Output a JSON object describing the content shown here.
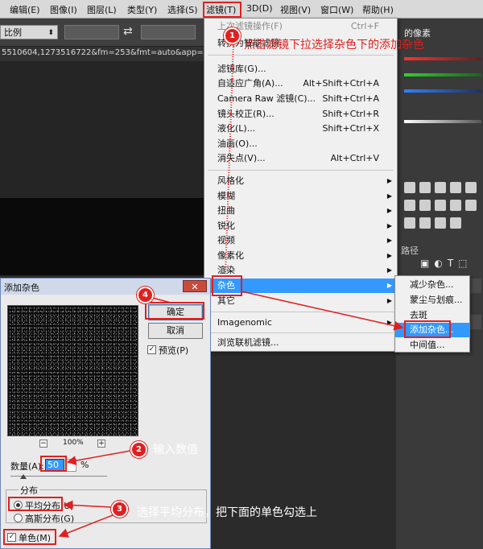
{
  "menubar": {
    "items": [
      "编辑(E)",
      "图像(I)",
      "图层(L)",
      "类型(Y)",
      "选择(S)",
      "滤镜(T)",
      "3D(D)",
      "视图(V)",
      "窗口(W)",
      "帮助(H)"
    ]
  },
  "options_bar": {
    "select_value": "比例",
    "swap_symbol": "⇄"
  },
  "tab": {
    "title": "5510604,1273516722&fm=253&fmt=auto&app=1"
  },
  "right_panel": {
    "title": "的像素",
    "layers_tab": "路径"
  },
  "filter_menu": {
    "last_filter": {
      "label": "上次滤镜操作(F)",
      "shortcut": "Ctrl+F"
    },
    "convert_smart": {
      "label": "转换为智能滤镜"
    },
    "group1": [
      {
        "label": "滤镜库(G)...",
        "shortcut": ""
      },
      {
        "label": "自适应广角(A)...",
        "shortcut": "Alt+Shift+Ctrl+A"
      },
      {
        "label": "Camera Raw 滤镜(C)...",
        "shortcut": "Shift+Ctrl+A"
      },
      {
        "label": "镜头校正(R)...",
        "shortcut": "Shift+Ctrl+R"
      },
      {
        "label": "液化(L)...",
        "shortcut": "Shift+Ctrl+X"
      },
      {
        "label": "油画(O)...",
        "shortcut": ""
      },
      {
        "label": "消失点(V)...",
        "shortcut": "Alt+Ctrl+V"
      }
    ],
    "group2": [
      "风格化",
      "模糊",
      "扭曲",
      "锐化",
      "视频",
      "像素化",
      "渲染",
      "杂色",
      "其它"
    ],
    "imagenomic": "Imagenomic",
    "browse_online": "浏览联机滤镜..."
  },
  "noise_submenu": {
    "items": [
      "减少杂色...",
      "蒙尘与划痕...",
      "去斑",
      "添加杂色...",
      "中间值..."
    ]
  },
  "add_noise_dialog": {
    "title": "添加杂色",
    "close_symbol": "✕",
    "ok_label": "确定",
    "cancel_label": "取消",
    "preview_label": "预览(P)",
    "zoom_minus": "−",
    "zoom_plus": "+",
    "zoom": "100%",
    "amount_label": "数量(A):",
    "amount_value": "50",
    "amount_unit": "%",
    "distribution_label": "分布",
    "uniform_label": "平均分布(U)",
    "gaussian_label": "高斯分布(G)",
    "monochromatic_label": "单色(M)",
    "check_mark": "✓"
  },
  "annotations": {
    "step1_num": "1",
    "step1_text": "点击滤镜下拉选择杂色下的添加杂色",
    "step2_num": "2",
    "step2_text": "输入数值",
    "step3_num": "3",
    "step3_text": "选择平均分布，把下面的单色勾选上",
    "step4_num": "4"
  },
  "colors": {
    "highlight": "#3399ff",
    "annotation_red": "#e02020"
  }
}
